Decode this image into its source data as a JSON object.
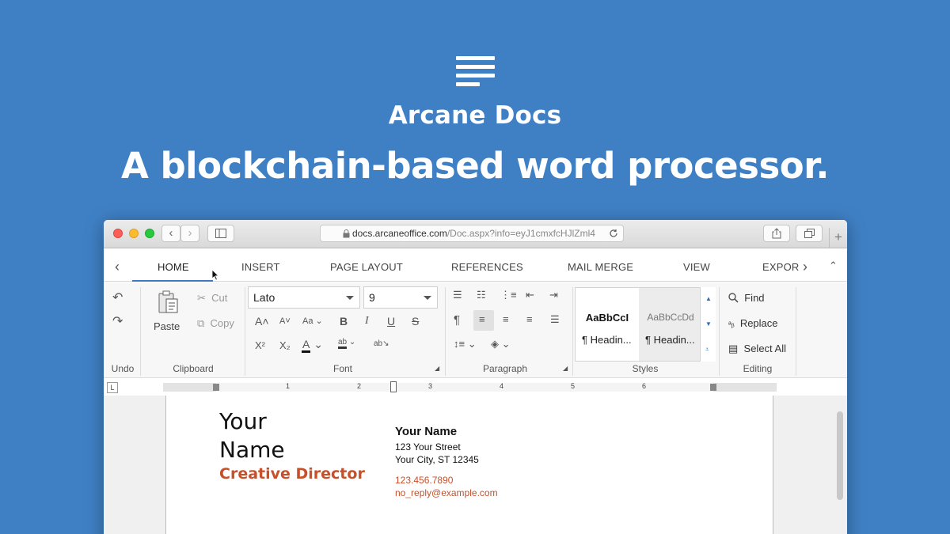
{
  "hero": {
    "brand": "Arcane Docs",
    "tagline": "A blockchain-based word processor.",
    "logo_icon": "lines-icon"
  },
  "browser": {
    "url_main": "docs.arcaneoffice.com",
    "url_rest": "/Doc.aspx?info=eyJ1cmxfcHJlZml4"
  },
  "tabs": [
    {
      "label": "HOME",
      "active": true
    },
    {
      "label": "INSERT"
    },
    {
      "label": "PAGE LAYOUT"
    },
    {
      "label": "REFERENCES"
    },
    {
      "label": "MAIL MERGE"
    },
    {
      "label": "VIEW"
    },
    {
      "label": "EXPOR"
    }
  ],
  "ribbon": {
    "undo_label": "Undo",
    "clipboard": {
      "label": "Clipboard",
      "paste": "Paste",
      "cut": "Cut",
      "copy": "Copy"
    },
    "font": {
      "label": "Font",
      "family": "Lato",
      "size": "9"
    },
    "paragraph": {
      "label": "Paragraph"
    },
    "styles": {
      "label": "Styles",
      "items": [
        {
          "sample": "AaBbCcI",
          "name": "Headin..."
        },
        {
          "sample": "AaBbCcDd",
          "name": "Headin..."
        }
      ]
    },
    "editing": {
      "label": "Editing",
      "find": "Find",
      "replace": "Replace",
      "select_all": "Select All"
    }
  },
  "ruler": {
    "corner": "L",
    "numbers": [
      "1",
      "2",
      "3",
      "4",
      "5",
      "6"
    ]
  },
  "document": {
    "name_line1": "Your",
    "name_line2": "Name",
    "role": "Creative Director",
    "contact_name": "Your Name",
    "street": "123 Your Street",
    "city": "Your City, ST 12345",
    "phone": "123.456.7890",
    "email": "no_reply@example.com"
  },
  "colors": {
    "background": "#3f80c5",
    "accent": "#c7502a",
    "tab_underline": "#3d79c2"
  }
}
